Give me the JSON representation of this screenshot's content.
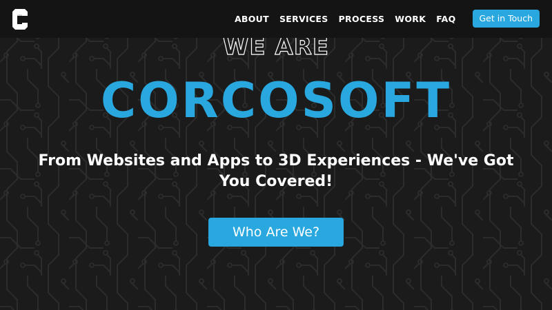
{
  "brand": {
    "logo_icon": "c-letter-logo-icon"
  },
  "nav": {
    "links": [
      "ABOUT",
      "SERVICES",
      "PROCESS",
      "WORK",
      "FAQ"
    ],
    "cta_label": "Get in Touch"
  },
  "hero": {
    "eyebrow": "WE ARE",
    "title": "CORCOSOFT",
    "tagline": "From Websites and Apps to 3D Experiences - We've Got You Covered!",
    "cta_label": "Who Are We?"
  },
  "colors": {
    "accent": "#29a8e0",
    "background": "#1b1b1b",
    "navbar": "#141414",
    "circuit_lines": "#2a2a2a"
  },
  "background_pattern": "circuit-board"
}
